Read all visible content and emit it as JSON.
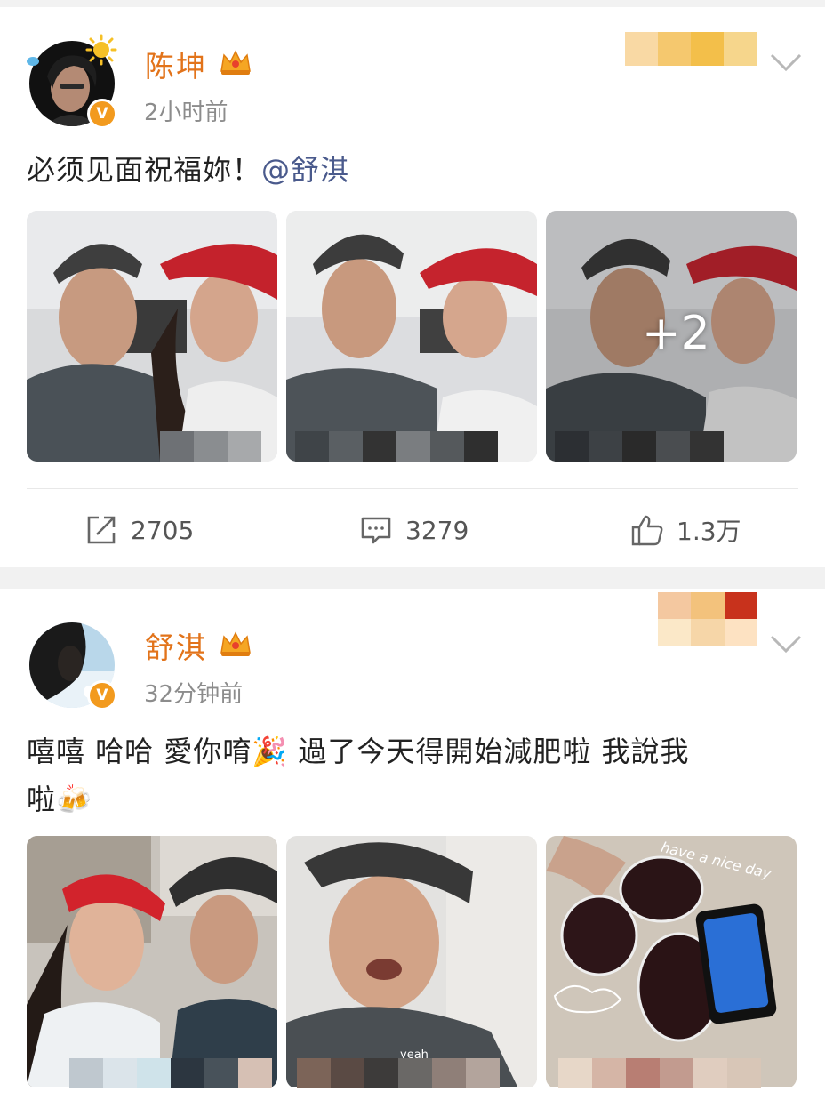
{
  "posts": [
    {
      "username": "陈坤",
      "time": "2小时前",
      "verified_mark": "V",
      "text_main": "必须见面祝福妳！",
      "text_mention": "@舒淇",
      "more_photos": "+2",
      "actions": {
        "repost": "2705",
        "comment": "3279",
        "like": "1.3万"
      }
    },
    {
      "username": "舒淇",
      "time": "32分钟前",
      "verified_mark": "V",
      "text_line1": "嘻嘻 哈哈 愛你唷🎉 過了今天得開始減肥啦 我說我",
      "text_line2": "啦🍻",
      "photo_caption": "yeah",
      "photo_doodle": "have a nice day"
    }
  ],
  "icons": [
    "sun-icon",
    "crown-icon",
    "chevron-down-icon",
    "repost-icon",
    "comment-icon",
    "like-icon",
    "verified-icon"
  ],
  "colors": {
    "username": "#e2731a",
    "mention": "#4a5a8c",
    "badge": "#f29a1e",
    "separator": "#f1f1f1"
  }
}
